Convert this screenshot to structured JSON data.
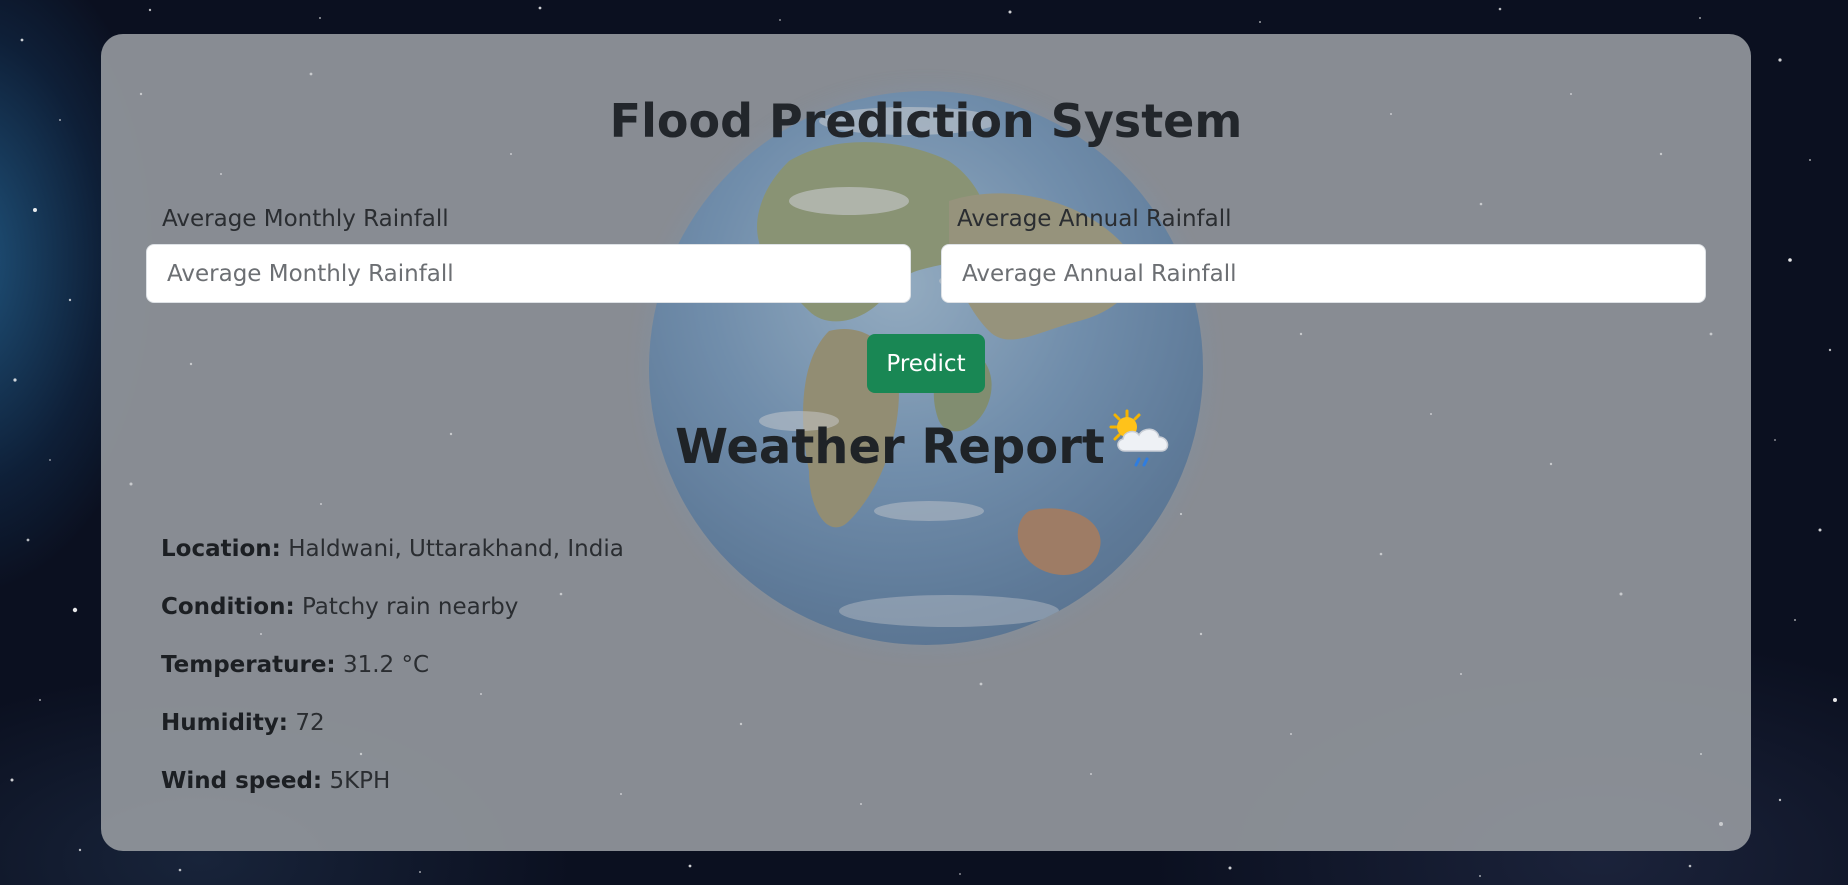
{
  "header": {
    "title": "Flood Prediction System"
  },
  "form": {
    "monthly": {
      "label": "Average Monthly Rainfall",
      "placeholder": "Average Monthly Rainfall",
      "value": ""
    },
    "annual": {
      "label": "Average Annual Rainfall",
      "placeholder": "Average Annual Rainfall",
      "value": ""
    },
    "predict_label": "Predict"
  },
  "weather": {
    "title": "Weather Report",
    "icon": "sun-behind-rain-cloud-icon",
    "rows": [
      {
        "key": "Location:",
        "value": "Haldwani, Uttarakhand, India"
      },
      {
        "key": "Condition:",
        "value": "Patchy rain nearby"
      },
      {
        "key": "Temperature:",
        "value": "31.2 °C"
      },
      {
        "key": "Humidity:",
        "value": "72"
      },
      {
        "key": "Wind speed:",
        "value": "5KPH"
      }
    ]
  },
  "colors": {
    "primary_button": "#198754",
    "card_background": "#969aa0",
    "page_background": "#0b1020"
  }
}
